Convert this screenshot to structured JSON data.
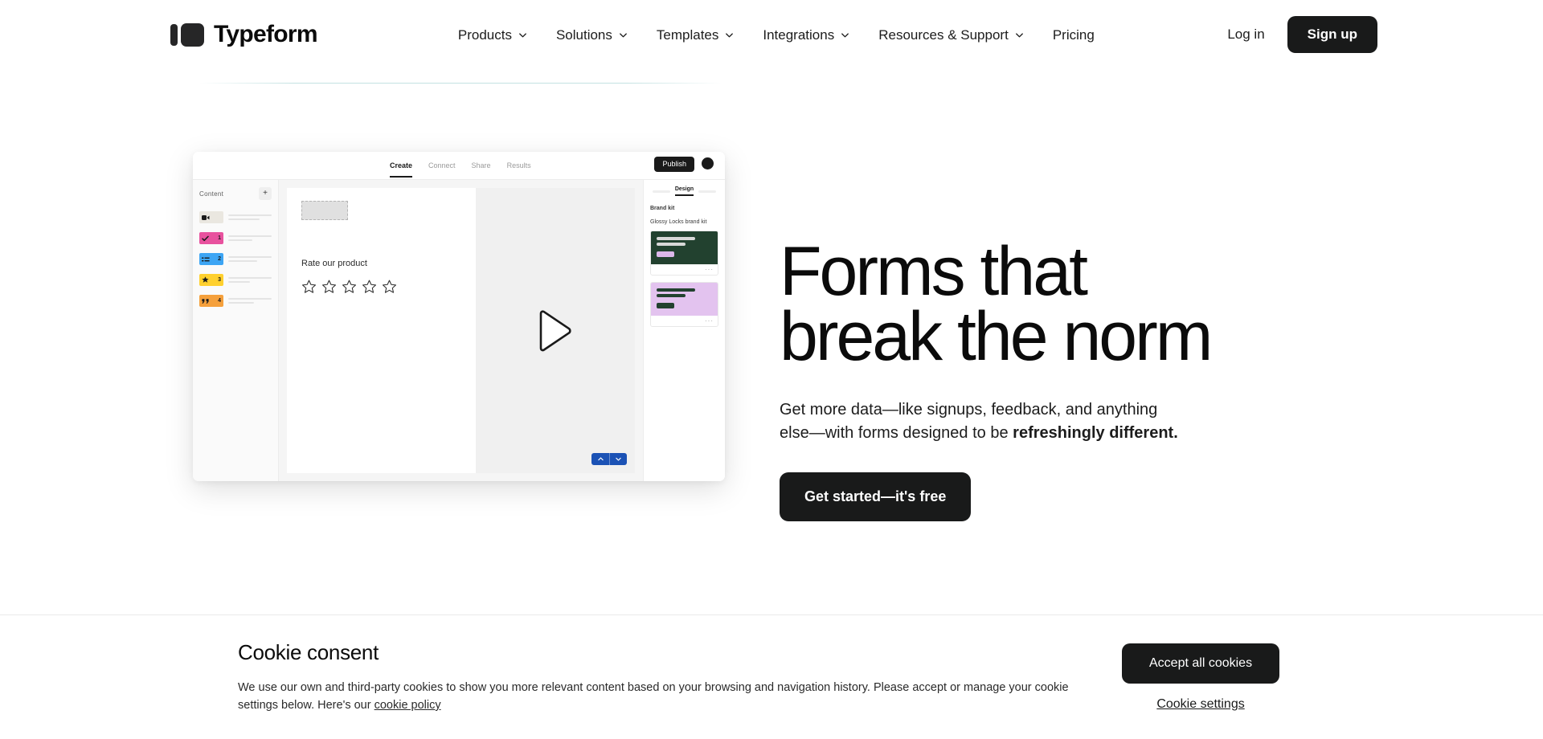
{
  "brand": {
    "name": "Typeform"
  },
  "nav": {
    "items": [
      {
        "label": "Products",
        "has_chevron": true
      },
      {
        "label": "Solutions",
        "has_chevron": true
      },
      {
        "label": "Templates",
        "has_chevron": true
      },
      {
        "label": "Integrations",
        "has_chevron": true
      },
      {
        "label": "Resources & Support",
        "has_chevron": true
      },
      {
        "label": "Pricing",
        "has_chevron": false
      }
    ],
    "login_label": "Log in",
    "signup_label": "Sign up"
  },
  "hero": {
    "headline": "Forms that\nbreak the norm",
    "subhead_lead": "Get more data—like signups, feedback, and anything else—with forms designed to be ",
    "subhead_bold": "refreshingly different.",
    "cta_label": "Get started—it's free"
  },
  "mockup": {
    "tabs": [
      {
        "label": "Create",
        "active": true
      },
      {
        "label": "Connect",
        "active": false
      },
      {
        "label": "Share",
        "active": false
      },
      {
        "label": "Results",
        "active": false
      }
    ],
    "publish_label": "Publish",
    "sidebar": {
      "title": "Content",
      "add_label": "+",
      "items": [
        {
          "number": "",
          "color": "#eae7e0",
          "icon": "video-icon"
        },
        {
          "number": "1",
          "color": "#e8529e",
          "icon": "check-icon"
        },
        {
          "number": "2",
          "color": "#3da5f4",
          "icon": "list-icon"
        },
        {
          "number": "3",
          "color": "#ffd02e",
          "icon": "star-icon"
        },
        {
          "number": "4",
          "color": "#f5a03c",
          "icon": "quote-icon"
        }
      ]
    },
    "canvas": {
      "question": "Rate our product",
      "star_count": 5
    },
    "design": {
      "tab_label": "Design",
      "brand_kit_label": "Brand kit",
      "kit_name": "Glossy Locks brand kit",
      "themes": [
        {
          "bg": "#22412f",
          "accent": "#dcb8ea",
          "line": "#d8d8d8",
          "dots": "···"
        },
        {
          "bg": "#e3c3ef",
          "accent": "#22412f",
          "line": "#22412f",
          "dots": "···"
        }
      ]
    }
  },
  "cookie": {
    "title": "Cookie consent",
    "body_part1": "We use our own and third-party cookies to show you more relevant content based on your browsing and navigation history. Please accept or manage your cookie settings below. Here's our ",
    "policy_link": "cookie policy",
    "accept_label": "Accept all cookies",
    "settings_label": "Cookie settings"
  },
  "colors": {
    "dark": "#191a1a",
    "accent_blue": "#1b52b5",
    "page_bg": "#ffffff"
  }
}
